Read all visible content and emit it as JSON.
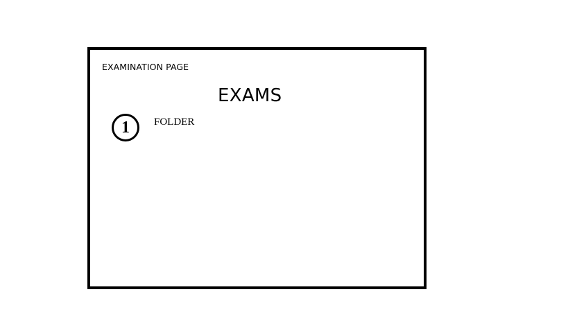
{
  "page": {
    "label": "EXAMINATION PAGE",
    "title": "EXAMS"
  },
  "folders": [
    {
      "number": "1",
      "label": "FOLDER"
    }
  ]
}
